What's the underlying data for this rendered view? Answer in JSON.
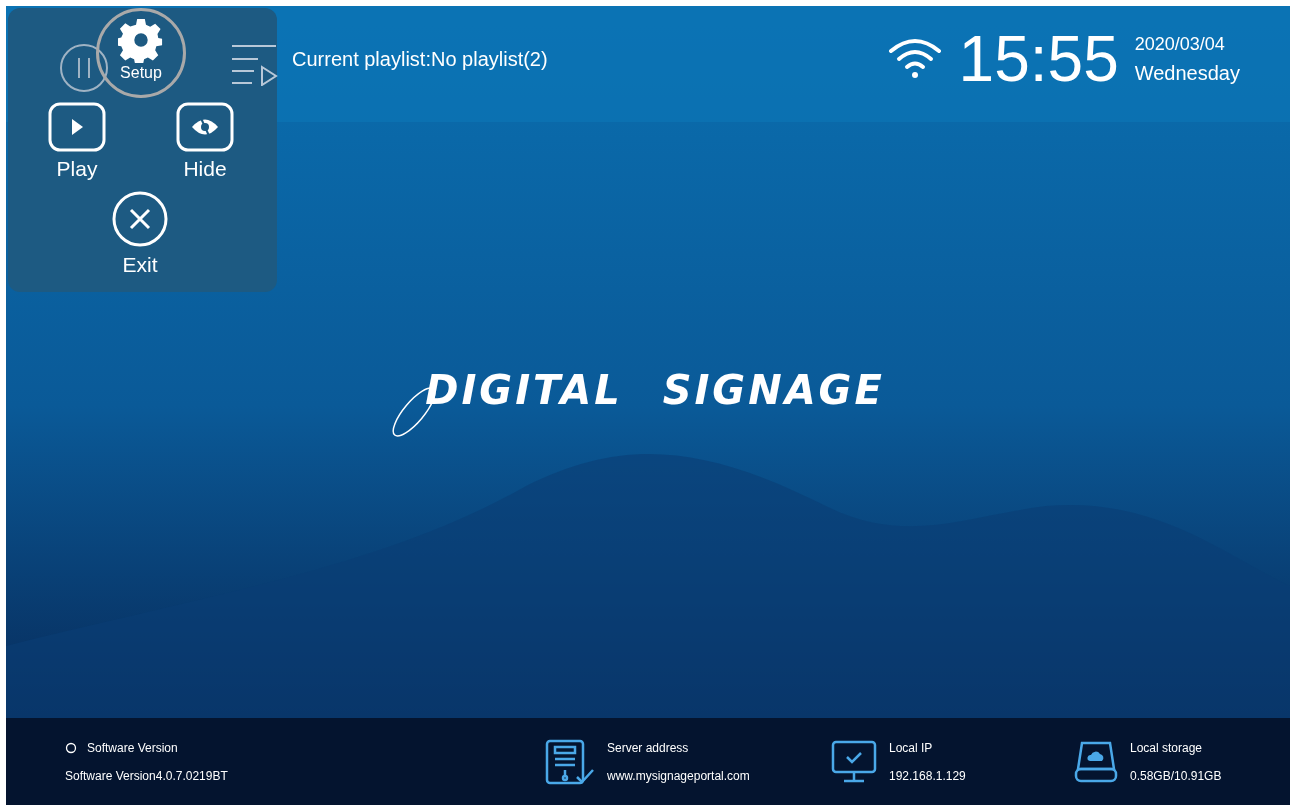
{
  "floating_menu": {
    "setup": {
      "label": "Setup"
    },
    "items": [
      {
        "kind": "play",
        "label": "Play"
      },
      {
        "kind": "hide",
        "label": "Hide"
      },
      {
        "kind": "exit",
        "label": "Exit"
      }
    ]
  },
  "top_bar": {
    "playlist": "Current playlist:No playlist(2)",
    "time": "15:55",
    "date": "2020/03/04",
    "weekday": "Wednesday"
  },
  "logo": [
    "DIGITAL",
    "SIGNAGE"
  ],
  "status_bar": [
    {
      "kind": "version",
      "title": "Software Version",
      "value": "Software Version4.0.7.0219BT"
    },
    {
      "kind": "server",
      "title": "Server address",
      "value": "www.mysignageportal.com"
    },
    {
      "kind": "ip",
      "title": "Local IP",
      "value": "192.168.1.129"
    },
    {
      "kind": "storage",
      "title": "Local storage",
      "value": "0.58GB/10.91GB"
    }
  ]
}
